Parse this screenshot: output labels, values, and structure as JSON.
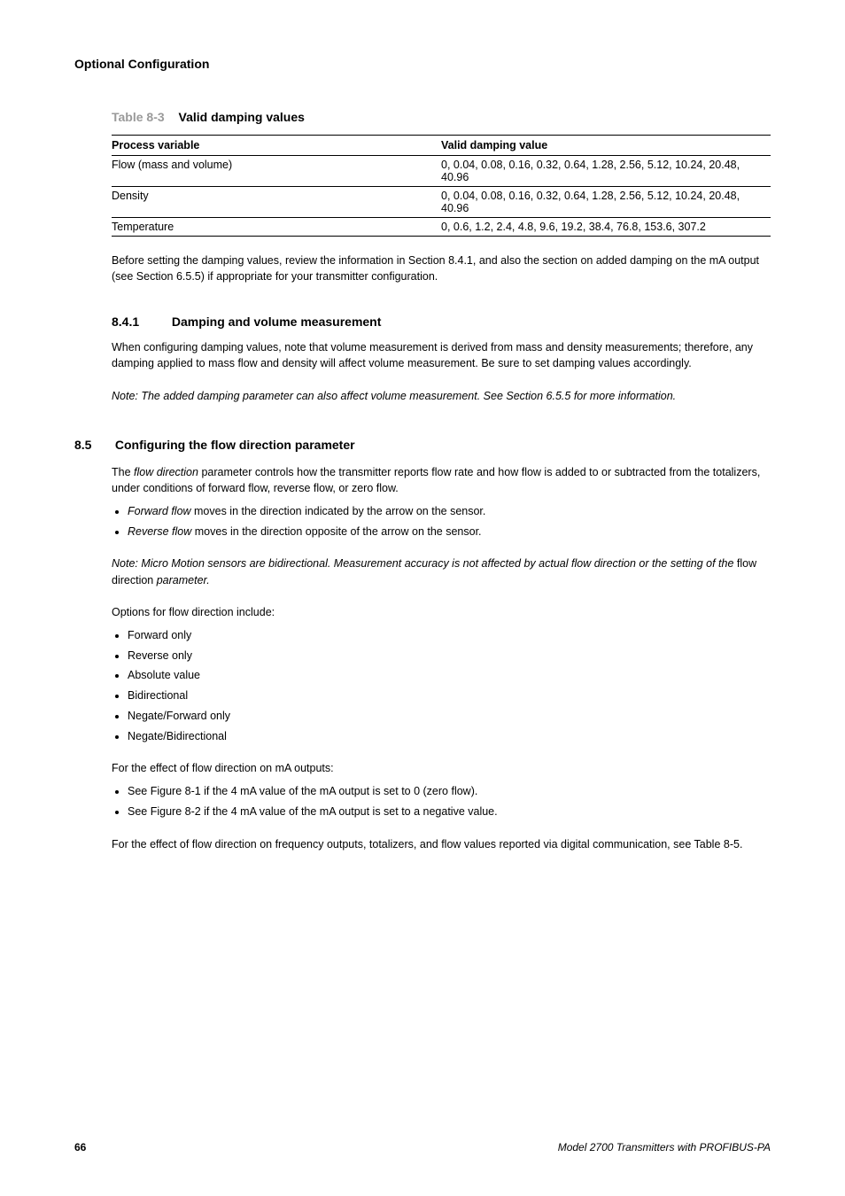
{
  "header": {
    "running": "Optional Configuration"
  },
  "table": {
    "label": "Table 8-3",
    "title": "Valid damping values",
    "col1": "Process variable",
    "col2": "Valid damping value",
    "rows": [
      {
        "pv": "Flow (mass and volume)",
        "vals": "0, 0.04, 0.08, 0.16, 0.32, 0.64, 1.28, 2.56, 5.12, 10.24, 20.48, 40.96"
      },
      {
        "pv": "Density",
        "vals": "0, 0.04, 0.08, 0.16, 0.32, 0.64, 1.28, 2.56, 5.12, 10.24, 20.48, 40.96"
      },
      {
        "pv": "Temperature",
        "vals": "0, 0.6, 1.2, 2.4, 4.8, 9.6, 19.2, 38.4, 76.8, 153.6, 307.2"
      }
    ],
    "note_before": "Before setting the damping values, review the information in Section 8.4.1, and also the section on added damping on the mA output (see Section 6.5.5) if appropriate for your transmitter configuration."
  },
  "sub841": {
    "num": "8.4.1",
    "title": "Damping and volume measurement",
    "p1": "When configuring damping values, note that volume measurement is derived from mass and density measurements; therefore, any damping applied to mass flow and density will affect volume measurement. Be sure to set damping values accordingly.",
    "p2_a": "Note: The added damping parameter can also affect volume measurement. See ",
    "p2_link": "Section 6.5.5",
    "p2_b": " for more information."
  },
  "sec85": {
    "num": "8.5",
    "title": "Configuring the flow direction parameter",
    "intro_a": "The ",
    "intro_i": "flow direction",
    "intro_b": " parameter controls how the transmitter reports flow rate and how flow is added to or subtracted from the totalizers, under conditions of forward flow, reverse flow, or zero flow.",
    "bullets": [
      {
        "t1": "Forward flow",
        "t2": " moves in the direction indicated by the arrow on the sensor."
      },
      {
        "t1": "Reverse flow",
        "t2": " moves in the direction opposite of the arrow on the sensor."
      }
    ],
    "arrow_a": "Note: Micro Motion sensors are bidirectional. Measurement accuracy is not affected by actual flow direction or the setting of the ",
    "arrow_i": "flow direction",
    "arrow_b": " parameter.",
    "opts_intro": "Options for flow direction include:",
    "options": [
      "Forward only",
      "Reverse only",
      "Absolute value",
      "Bidirectional",
      "Negate/Forward only",
      "Negate/Bidirectional"
    ],
    "effects_intro": "For the effect of flow direction on mA outputs:",
    "effects": [
      "See Figure 8-1 if the 4 mA value of the mA output is set to 0 (zero flow).",
      "See Figure 8-2 if the 4 mA value of the mA output is set to a negative value."
    ],
    "closing": "For the effect of flow direction on frequency outputs, totalizers, and flow values reported via digital communication, see Table 8-5."
  },
  "footer": {
    "page": "66",
    "doc": "Model 2700 Transmitters with PROFIBUS-PA"
  }
}
